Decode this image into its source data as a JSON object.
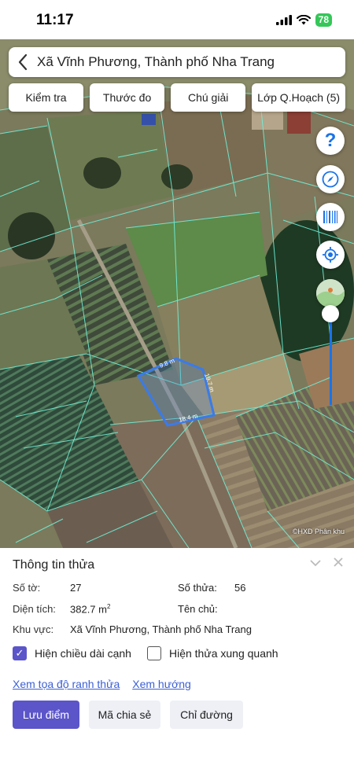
{
  "status_bar": {
    "time": "11:17",
    "battery": "78"
  },
  "search": {
    "title": "Xã Vĩnh Phương, Thành phố Nha Trang"
  },
  "toolbar": [
    {
      "label": "Kiểm tra"
    },
    {
      "label": "Thước đo"
    },
    {
      "label": "Chú giải"
    },
    {
      "label": "Lớp Q.Hoạch (5)"
    }
  ],
  "map": {
    "edge_labels": {
      "top": "9.8 m",
      "right": "19.7 m",
      "bottom": "18.4 m"
    },
    "credit": "©HXD Phân khu",
    "parcel_color": "#3b7be8",
    "boundary_color": "#6ff0d8"
  },
  "panel": {
    "title": "Thông tin thửa",
    "so_to_label": "Số tờ:",
    "so_to_value": "27",
    "so_thua_label": "Số thửa:",
    "so_thua_value": "56",
    "dien_tich_label": "Diện tích:",
    "dien_tich_value": "382.7 m",
    "dien_tich_unit_sup": "2",
    "ten_chu_label": "Tên chủ:",
    "ten_chu_value": "",
    "khu_vuc_label": "Khu vực:",
    "khu_vuc_value": "Xã Vĩnh Phương, Thành phố Nha Trang",
    "checkbox_edges_label": "Hiện chiều dài cạnh",
    "checkbox_edges_checked": true,
    "checkbox_neighbors_label": "Hiện thửa xung quanh",
    "checkbox_neighbors_checked": false,
    "link_coordinates": "Xem tọa độ ranh thửa",
    "link_direction": "Xem hướng",
    "btn_save": "Lưu điểm",
    "btn_share": "Mã chia sẻ",
    "btn_directions": "Chỉ đường",
    "accent_color": "#5b55c9"
  }
}
